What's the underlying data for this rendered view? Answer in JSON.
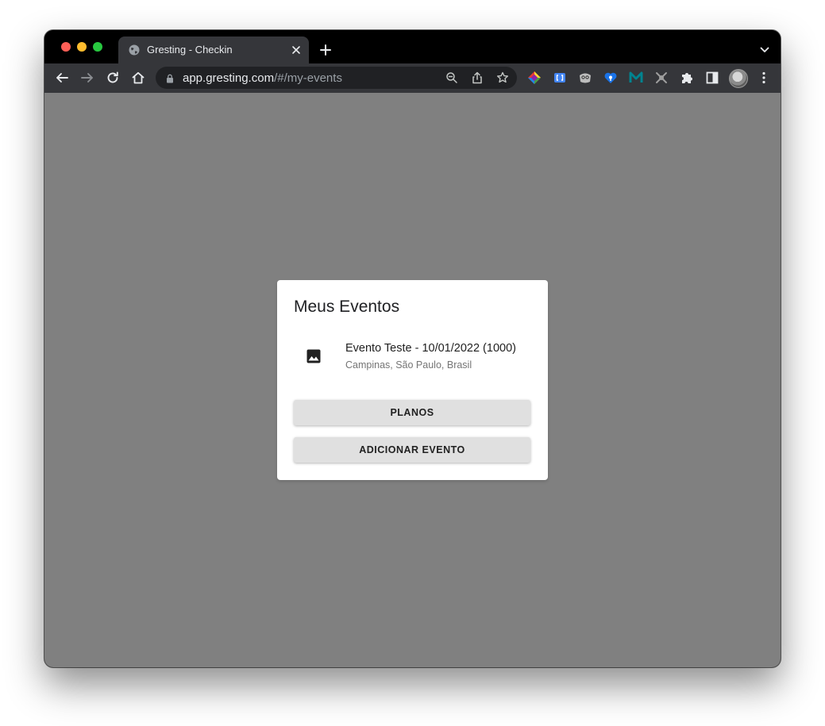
{
  "browser": {
    "tab": {
      "title": "Gresting - Checkin"
    },
    "address_bar": {
      "host": "app.gresting.com",
      "path": "/#/my-events"
    },
    "colors": {
      "tab_strip": "#000000",
      "toolbar": "#35363a",
      "omnibox": "#202124"
    }
  },
  "page": {
    "background": "#808080",
    "card": {
      "title": "Meus Eventos",
      "events": [
        {
          "name": "Evento Teste - 10/01/2022 (1000)",
          "location": "Campinas, São Paulo, Brasil",
          "icon": "image-icon"
        }
      ],
      "buttons": {
        "plans_label": "PLANOS",
        "add_event_label": "ADICIONAR EVENTO"
      }
    }
  }
}
